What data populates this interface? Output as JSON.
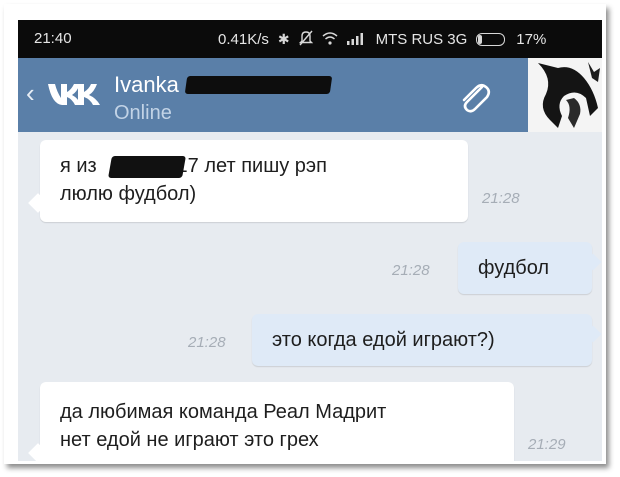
{
  "status_bar": {
    "time": "21:40",
    "speed": "0.41K/s",
    "carrier": "MTS RUS 3G",
    "battery": "17%"
  },
  "header": {
    "contact_name": "Ivanka",
    "contact_status": "Online",
    "accent_color": "#5a7fa8"
  },
  "messages": [
    {
      "direction": "incoming",
      "text_part1": "я из",
      "text_part2": "а 17 лет пишу рэп",
      "text_line2": "люлю фудбол)",
      "time": "21:28"
    },
    {
      "direction": "outgoing",
      "text": "фудбол",
      "time": "21:28"
    },
    {
      "direction": "outgoing",
      "text": "это когда едой играют?)",
      "time": "21:28"
    },
    {
      "direction": "incoming",
      "text": "да любимая команда Реал Мадрит\nнет едой не играют это грех",
      "time": "21:29"
    }
  ]
}
